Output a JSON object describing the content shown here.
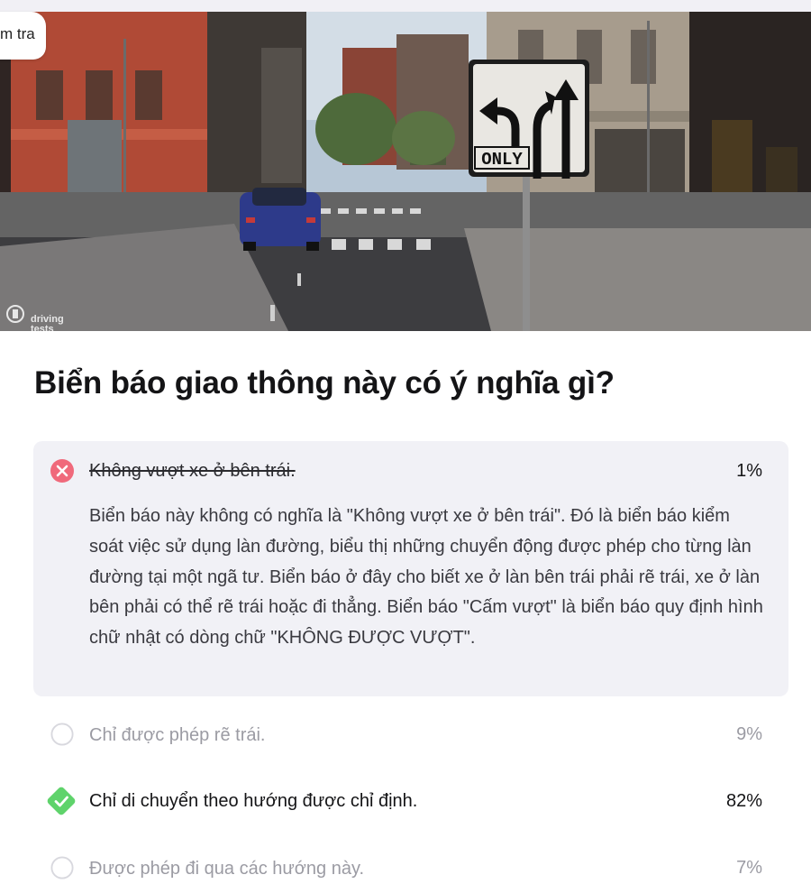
{
  "header": {
    "badge_text": "m tra"
  },
  "image": {
    "sign_text": "ONLY",
    "watermark_line1": "driving",
    "watermark_line2": "tests"
  },
  "question": {
    "text": "Biển báo giao thông này có ý nghĩa gì?"
  },
  "answers": [
    {
      "label": "Không vượt xe ở bên trái.",
      "percent": "1%",
      "state": "wrong",
      "explanation": "Biển báo này không có nghĩa là \"Không vượt xe ở bên trái\". Đó là biển báo kiểm soát việc sử dụng làn đường, biểu thị những chuyển động được phép cho từng làn đường tại một ngã tư. Biển báo ở đây cho biết xe ở làn bên trái phải rẽ trái, xe ở làn bên phải có thể rẽ trái hoặc đi thẳng. Biển báo \"Cấm vượt\" là biển báo quy định hình chữ nhật có dòng chữ \"KHÔNG ĐƯỢC VƯỢT\"."
    },
    {
      "label": "Chỉ được phép rẽ trái.",
      "percent": "9%",
      "state": "neutral"
    },
    {
      "label": "Chỉ di chuyển theo hướng được chỉ định.",
      "percent": "82%",
      "state": "correct"
    },
    {
      "label": "Được phép đi qua các hướng này.",
      "percent": "7%",
      "state": "neutral"
    }
  ],
  "colors": {
    "wrong": "#f0697b",
    "correct": "#5fd36b",
    "neutral_ring": "#d8d8de",
    "panel": "#f1f1f6"
  }
}
